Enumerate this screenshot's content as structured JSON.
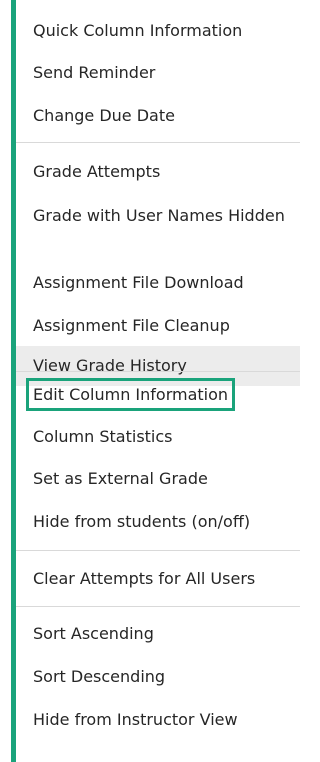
{
  "menu": {
    "items": [
      {
        "label": "Quick Column Information"
      },
      {
        "label": "Send Reminder"
      },
      {
        "label": "Change Due Date"
      },
      {
        "label": "Grade Attempts"
      },
      {
        "label": "Grade with User Names Hidden"
      },
      {
        "label": "Assignment File Download"
      },
      {
        "label": "Assignment File Cleanup"
      },
      {
        "label": "View Grade History"
      },
      {
        "label": "Edit Column Information"
      },
      {
        "label": "Column Statistics"
      },
      {
        "label": "Set as External Grade"
      },
      {
        "label": "Hide from students (on/off)"
      },
      {
        "label": "Clear Attempts for All Users"
      },
      {
        "label": "Sort Ascending"
      },
      {
        "label": "Sort Descending"
      },
      {
        "label": "Hide from Instructor View"
      }
    ]
  },
  "colors": {
    "accent": "#1aa37b",
    "hover_background": "#ececec",
    "text": "#262626",
    "divider": "#d9d9d9"
  }
}
